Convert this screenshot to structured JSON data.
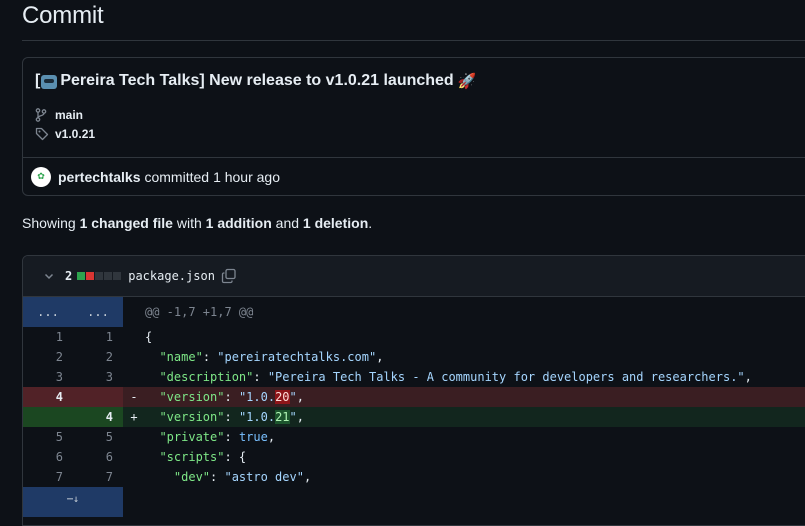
{
  "page": {
    "title": "Commit"
  },
  "commit": {
    "message": "[🤖 Pereira Tech Talks] New release to v1.0.21 launched",
    "message_prefix": "[",
    "message_text": "Pereira Tech Talks] New release to v1.0.21 launched",
    "branch": "main",
    "tag": "v1.0.21",
    "author": "pertechtalks",
    "action": "committed",
    "time": "1 hour ago"
  },
  "summary": {
    "prefix": "Showing",
    "changed": "1 changed file",
    "with": "with",
    "additions": "1 addition",
    "and": "and",
    "deletions": "1 deletion",
    "suffix": "."
  },
  "file": {
    "change_count": "2",
    "name": "package.json",
    "diffstat": [
      "add",
      "del",
      "neutral",
      "neutral",
      "neutral"
    ]
  },
  "diff": {
    "hunk_left": "...",
    "hunk_right": "...",
    "hunk_header": "@@ -1,7 +1,7 @@",
    "lines": [
      {
        "type": "ctx",
        "old": "1",
        "new": "1",
        "mark": "",
        "code": "{"
      },
      {
        "type": "ctx",
        "old": "2",
        "new": "2",
        "mark": "",
        "code": "  \"name\": \"pereiratechtalks.com\","
      },
      {
        "type": "ctx",
        "old": "3",
        "new": "3",
        "mark": "",
        "code": "  \"description\": \"Pereira Tech Talks - A community for developers and researchers.\","
      },
      {
        "type": "del",
        "old": "4",
        "new": "",
        "mark": "-",
        "code": "  \"version\": \"1.0.20\","
      },
      {
        "type": "add",
        "old": "",
        "new": "4",
        "mark": "+",
        "code": "  \"version\": \"1.0.21\","
      },
      {
        "type": "ctx",
        "old": "5",
        "new": "5",
        "mark": "",
        "code": "  \"private\": true,"
      },
      {
        "type": "ctx",
        "old": "6",
        "new": "6",
        "mark": "",
        "code": "  \"scripts\": {"
      },
      {
        "type": "ctx",
        "old": "7",
        "new": "7",
        "mark": "",
        "code": "    \"dev\": \"astro dev\","
      }
    ],
    "expand_glyph": "⋯↓"
  },
  "colors": {
    "bg": "#0d1117",
    "add": "#2da44e",
    "del": "#da3633",
    "neutral": "#30363d"
  },
  "icons": {
    "branch": "git-branch-icon",
    "tag": "tag-icon",
    "chevron": "chevron-down-icon",
    "copy": "copy-icon",
    "expand": "expand-down-icon"
  }
}
